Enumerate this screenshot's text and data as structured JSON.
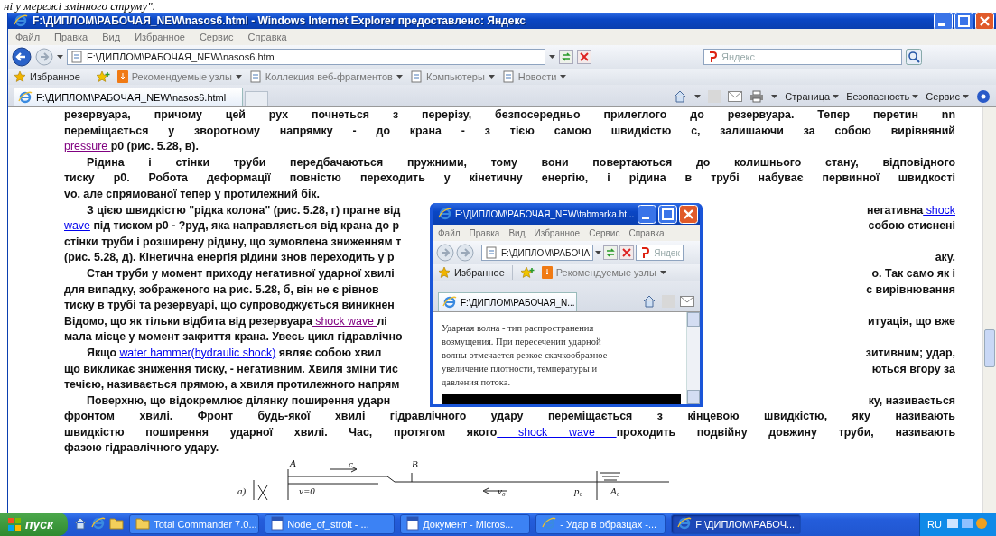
{
  "caption": "ні у мережі змінного струму\".",
  "browser": {
    "title": "F:\\ДИПЛОМ\\РАБОЧАЯ_NEW\\nasos6.html - Windows Internet Explorer предоставлено: Яндекс",
    "menu": [
      "Файл",
      "Правка",
      "Вид",
      "Избранное",
      "Сервис",
      "Справка"
    ],
    "address": "F:\\ДИПЛОМ\\РАБОЧАЯ_NEW\\nasos6.htm",
    "search_placeholder": "Яндекс",
    "favorites": [
      "Избранное",
      "Рекомендуемые узлы",
      "Коллекция веб-фрагментов",
      "Компьютеры",
      "Новости"
    ],
    "tab": "F:\\ДИПЛОМ\\РАБОЧАЯ_NEW\\nasos6.html",
    "commands": [
      "Страница",
      "Безопасность",
      "Сервис"
    ]
  },
  "content": {
    "lines": [
      {
        "first": false,
        "left": [
          {
            "text": "резервуара, причому цей рух почнеться з перерізу, безпосередньо прилеглого до резервуара. Тепер перетин nn"
          }
        ]
      },
      {
        "first": false,
        "left": [
          {
            "text": "переміщається у зворотному напрямку - до крана - з тією самою швидкістю с, залишаючи за собою вирівняний"
          }
        ]
      },
      {
        "first": false,
        "left": [
          {
            "link": "pressure ",
            "visited": true
          },
          {
            "text": "p0 (рис. 5.28, в)."
          }
        ]
      },
      {
        "first": true,
        "left": [
          {
            "text": "Рідина і стінки труби передбачаються пружними, тому вони повертаються до колишнього стану, відповідного"
          }
        ]
      },
      {
        "first": false,
        "left": [
          {
            "text": "тиску p0. Робота деформації повністю переходить у кінетичну енергію, і рідина в трубі набуває первинної швидкості"
          }
        ]
      },
      {
        "first": false,
        "left": [
          {
            "text": "vo, але спрямованої тепер у протилежний бік."
          }
        ]
      },
      {
        "first": true,
        "left": [
          {
            "text": "З цією швидкістю \"рідка колона\" (рис. 5.28, г) прагне від"
          }
        ],
        "right": [
          {
            "text": "негативна"
          },
          {
            "link": " shock",
            "visited": false
          }
        ]
      },
      {
        "first": false,
        "left": [
          {
            "link": "wave",
            "visited": false
          },
          {
            "text": " під тиском p0 - ?руд, яка направляється від крана до р"
          }
        ],
        "right": [
          {
            "text": "собою стиснені"
          }
        ]
      },
      {
        "first": false,
        "left": [
          {
            "text": "стінки труби і розширену рідину, що зумовлена зниженням т"
          }
        ]
      },
      {
        "first": false,
        "left": [
          {
            "text": "(рис. 5.28, д). Кінетична енергія рідини знов переходить у р"
          }
        ],
        "right": [
          {
            "text": "аку."
          }
        ]
      },
      {
        "first": true,
        "left": [
          {
            "text": "Стан труби у момент приходу негативної ударної хвилі"
          }
        ],
        "right": [
          {
            "text": "о. Так само як і"
          }
        ]
      },
      {
        "first": false,
        "left": [
          {
            "text": "для випадку, зображеного на рис. 5.28, б, він не є рівнов"
          }
        ],
        "right": [
          {
            "text": "с вирівнювання"
          }
        ]
      },
      {
        "first": false,
        "left": [
          {
            "text": "тиску в трубі та резервуарі, що супроводжується виникнен"
          }
        ]
      },
      {
        "first": false,
        "left": [
          {
            "text": "Відомо, що як тільки відбита від резервуара"
          },
          {
            "link": " shock wave ",
            "visited": true
          },
          {
            "text": "лі"
          }
        ],
        "right": [
          {
            "text": "итуація, що вже"
          }
        ]
      },
      {
        "first": false,
        "left": [
          {
            "text": "мала місце у момент закриття крана. Увесь цикл гідравлічно"
          }
        ]
      },
      {
        "first": true,
        "left": [
          {
            "text": "Якщо "
          },
          {
            "link": "water hammer(hydraulic shock)",
            "visited": false
          },
          {
            "text": " являє собою хвил"
          }
        ],
        "right": [
          {
            "text": "зитивним; удар,"
          }
        ]
      },
      {
        "first": false,
        "left": [
          {
            "text": "що викликає зниження тиску, - негативним. Хвиля зміни тис"
          }
        ],
        "right": [
          {
            "text": "ються вгору за"
          }
        ]
      },
      {
        "first": false,
        "left": [
          {
            "text": "течією, називається прямою, а хвиля протилежного напрям"
          }
        ]
      },
      {
        "first": true,
        "left": [
          {
            "text": "Поверхню, що відокремлює ділянку поширення ударн"
          }
        ],
        "right": [
          {
            "text": "ку, називається"
          }
        ]
      },
      {
        "first": false,
        "left": [
          {
            "text": "фронтом хвилі. Фронт будь-якої хвилі гідравлічного удару переміщається з кінцевою швидкістю, яку називають"
          }
        ]
      },
      {
        "first": false,
        "left": [
          {
            "text": "швидкістю поширення ударної хвилі. Час, протягом якого"
          },
          {
            "link": " shock wave ",
            "visited": false
          },
          {
            "text": "проходить подвійну довжину труби, називають"
          }
        ]
      },
      {
        "first": false,
        "left": [
          {
            "text": "фазою гідравлічного удару."
          }
        ]
      }
    ]
  },
  "diagram": {
    "labels": [
      "A",
      "c",
      "B",
      "a)",
      "v=0",
      "v₀",
      "p₀",
      "A₀"
    ]
  },
  "popup": {
    "title": "F:\\ДИПЛОМ\\РАБОЧАЯ_NEW\\tabmarka.ht...",
    "menu": [
      "Файл",
      "Правка",
      "Вид",
      "Избранное",
      "Сервис",
      "Справка"
    ],
    "address": "F:\\ДИПЛОМ\\РАБОЧА",
    "search_placeholder": "Яндек",
    "favorites": [
      "Избранное",
      "Рекомендуемые узлы"
    ],
    "tab": "F:\\ДИПЛОМ\\РАБОЧАЯ_N...",
    "text_lines": [
      "Ударная волна - тип распространения",
      "возмущения. При пересечении ударной",
      "волны отмечается резкое скачкообразное",
      "увеличение плотности, температуры и",
      "давления потока."
    ]
  },
  "taskbar": {
    "start": "пуск",
    "items": [
      {
        "label": "Total Commander 7.0...",
        "kind": "folder",
        "selected": false
      },
      {
        "label": "Node_of_stroit - ...",
        "kind": "doc",
        "selected": false
      },
      {
        "label": "Документ - Micros...",
        "kind": "doc",
        "selected": false
      },
      {
        "label": "- Удар в образцах -...",
        "kind": "ie",
        "selected": false
      },
      {
        "label": "F:\\ДИПЛОМ\\РАБОЧ...",
        "kind": "ie",
        "selected": true
      }
    ],
    "language": "RU"
  }
}
